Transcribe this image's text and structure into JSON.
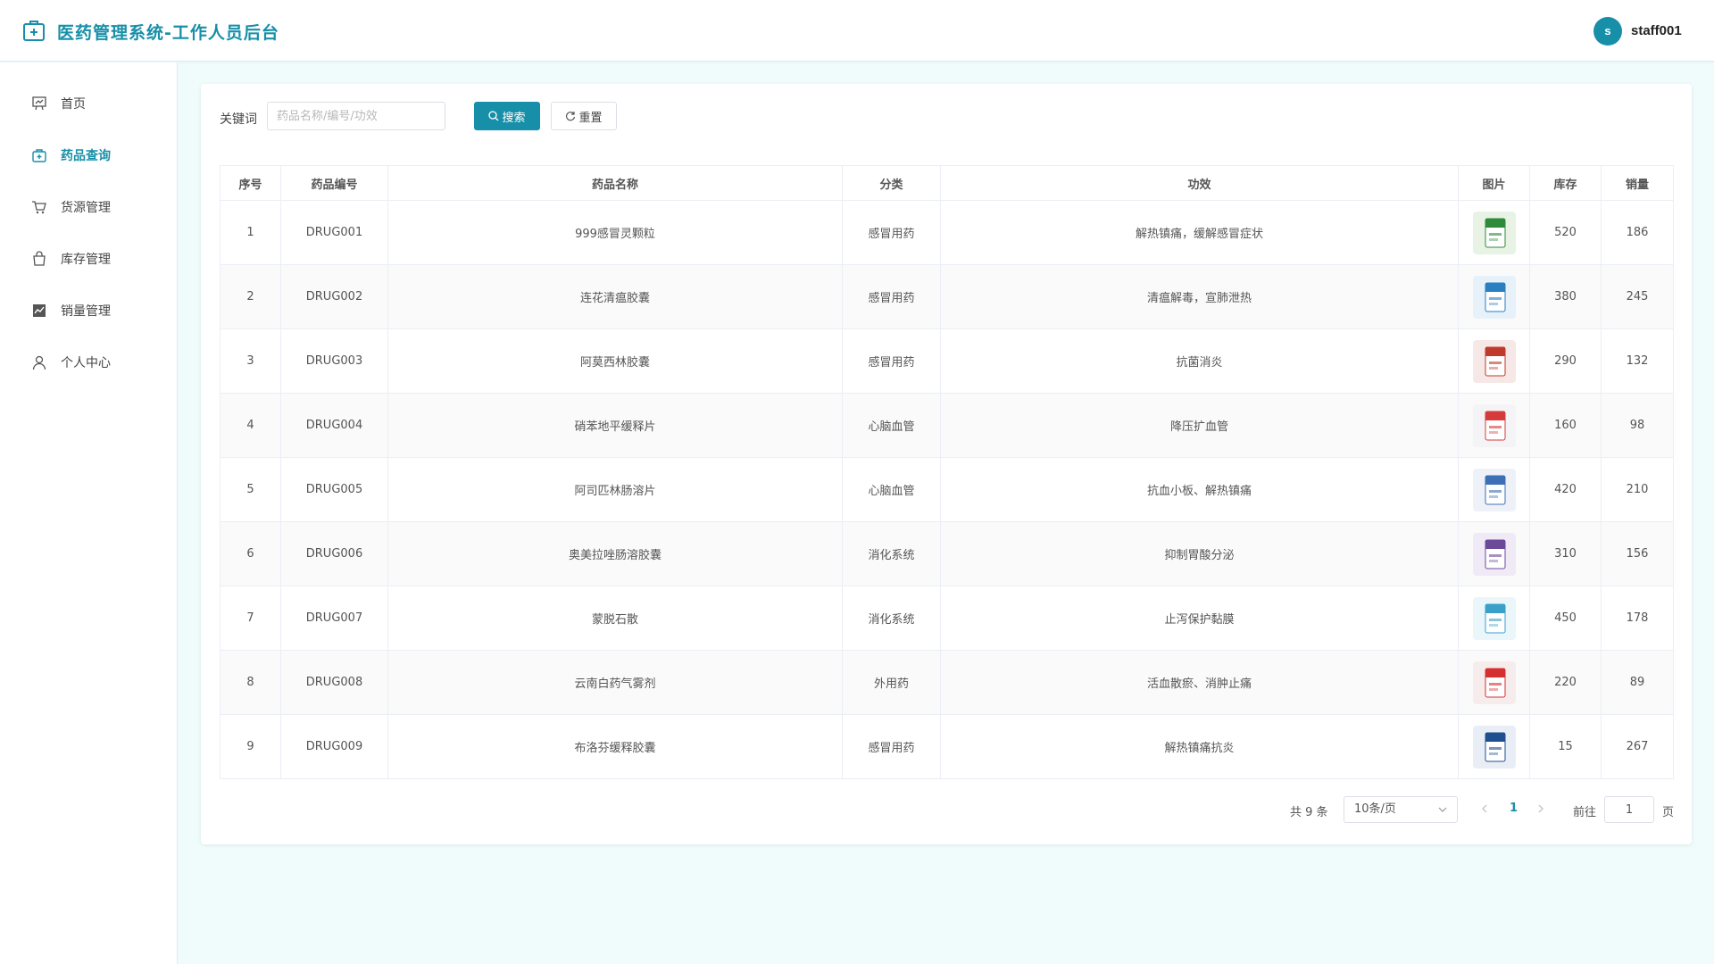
{
  "header": {
    "title": "医药管理系统-工作人员后台",
    "avatar_letter": "s",
    "username": "staff001",
    "accent_color": "#178fa8"
  },
  "sidebar": {
    "items": [
      {
        "label": "首页",
        "icon": "dashboard-icon",
        "active": false
      },
      {
        "label": "药品查询",
        "icon": "medical-kit-icon",
        "active": true
      },
      {
        "label": "货源管理",
        "icon": "cart-icon",
        "active": false
      },
      {
        "label": "库存管理",
        "icon": "bag-icon",
        "active": false
      },
      {
        "label": "销量管理",
        "icon": "sales-chart-icon",
        "active": false
      },
      {
        "label": "个人中心",
        "icon": "user-icon",
        "active": false
      }
    ]
  },
  "search": {
    "label": "关键词",
    "placeholder": "药品名称/编号/功效",
    "value": "",
    "search_label": "搜索",
    "reset_label": "重置"
  },
  "table": {
    "columns": [
      "序号",
      "药品编号",
      "药品名称",
      "分类",
      "功效",
      "图片",
      "库存",
      "销量"
    ],
    "rows": [
      {
        "index": "1",
        "code": "DRUG001",
        "name": "999感冒灵颗粒",
        "category": "感冒用药",
        "effect": "解热镇痛，缓解感冒症状",
        "image": "drug-box-green",
        "stock": "520",
        "sales": "186"
      },
      {
        "index": "2",
        "code": "DRUG002",
        "name": "连花清瘟胶囊",
        "category": "感冒用药",
        "effect": "清瘟解毒，宣肺泄热",
        "image": "drug-box-blue",
        "stock": "380",
        "sales": "245"
      },
      {
        "index": "3",
        "code": "DRUG003",
        "name": "阿莫西林胶囊",
        "category": "感冒用药",
        "effect": "抗菌消炎",
        "image": "drug-box-red",
        "stock": "290",
        "sales": "132"
      },
      {
        "index": "4",
        "code": "DRUG004",
        "name": "硝苯地平缓释片",
        "category": "心脑血管",
        "effect": "降压扩血管",
        "image": "drug-box-white-red",
        "stock": "160",
        "sales": "98"
      },
      {
        "index": "5",
        "code": "DRUG005",
        "name": "阿司匹林肠溶片",
        "category": "心脑血管",
        "effect": "抗血小板、解热镇痛",
        "image": "drug-bottle-blue",
        "stock": "420",
        "sales": "210"
      },
      {
        "index": "6",
        "code": "DRUG006",
        "name": "奥美拉唑肠溶胶囊",
        "category": "消化系统",
        "effect": "抑制胃酸分泌",
        "image": "drug-box-purple",
        "stock": "310",
        "sales": "156"
      },
      {
        "index": "7",
        "code": "DRUG007",
        "name": "蒙脱石散",
        "category": "消化系统",
        "effect": "止泻保护黏膜",
        "image": "drug-sachet",
        "stock": "450",
        "sales": "178"
      },
      {
        "index": "8",
        "code": "DRUG008",
        "name": "云南白药气雾剂",
        "category": "外用药",
        "effect": "活血散瘀、消肿止痛",
        "image": "drug-spray-red",
        "stock": "220",
        "sales": "89"
      },
      {
        "index": "9",
        "code": "DRUG009",
        "name": "布洛芬缓释胶囊",
        "category": "感冒用药",
        "effect": "解热镇痛抗炎",
        "image": "drug-box-navy",
        "stock": "15",
        "sales": "267"
      }
    ]
  },
  "pagination": {
    "total_text": "共 9 条",
    "page_size": "10条/页",
    "current_page": "1",
    "goto_label": "前往",
    "goto_value": "1",
    "goto_suffix": "页"
  }
}
